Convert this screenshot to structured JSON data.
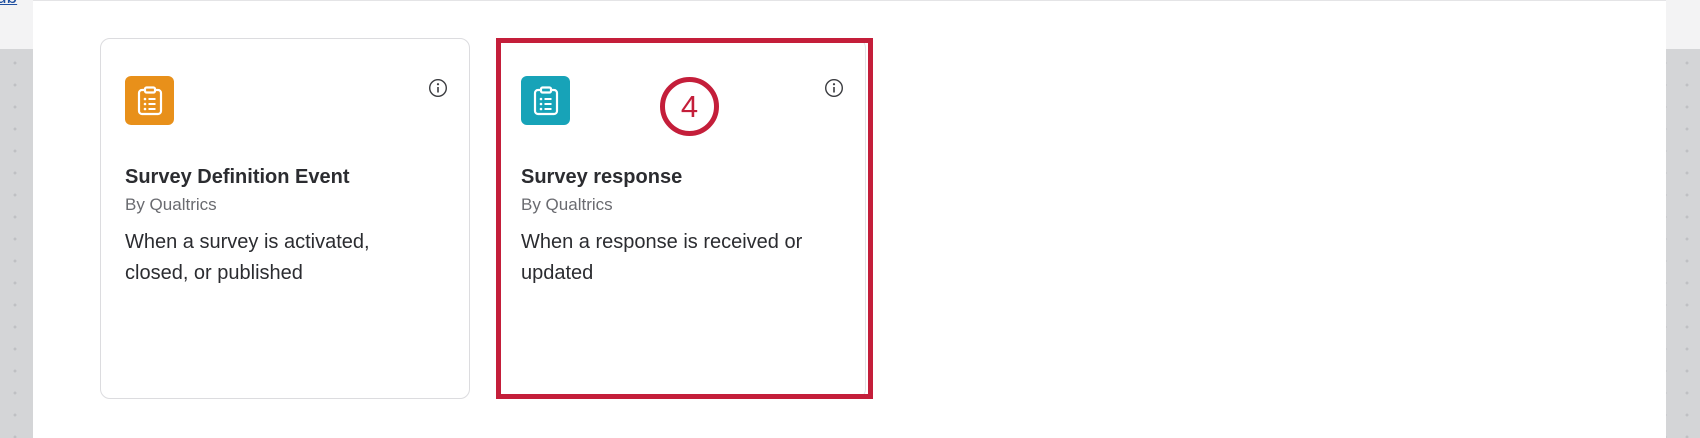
{
  "background": {
    "tab_fragment": "ub"
  },
  "cards": [
    {
      "title": "Survey Definition Event",
      "provider": "By Qualtrics",
      "description": "When a survey is activated, closed, or published",
      "icon": "clipboard-list-icon",
      "icon_color": "#e8901a"
    },
    {
      "title": "Survey response",
      "provider": "By Qualtrics",
      "description": "When a response is received or updated",
      "icon": "clipboard-list-icon",
      "icon_color": "#17a3b8"
    }
  ],
  "annotation": {
    "step_number": "4",
    "color": "#c41e3a"
  },
  "info_icon": "info-icon"
}
